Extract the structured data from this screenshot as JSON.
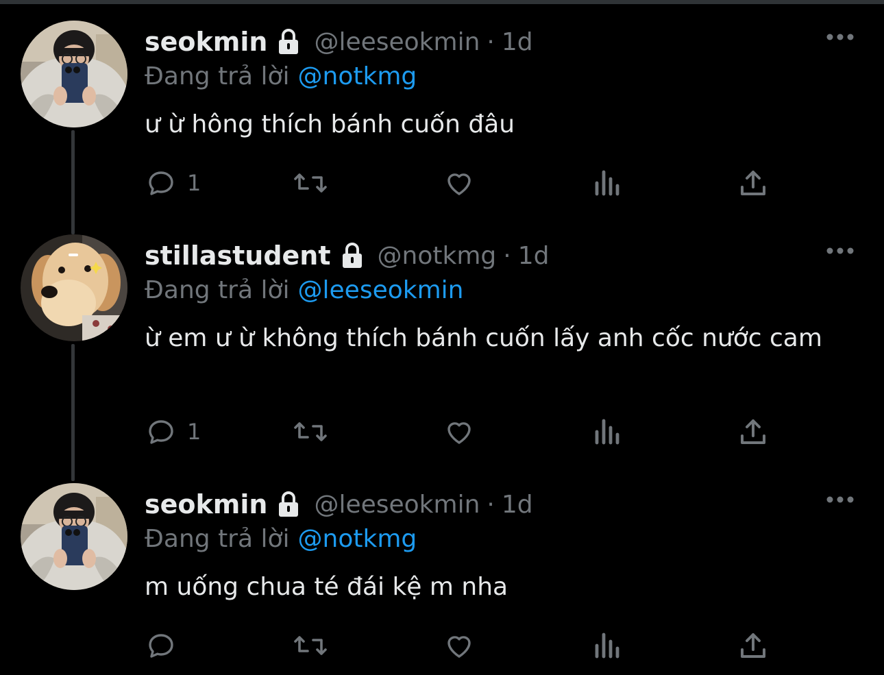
{
  "colors": {
    "background": "#000000",
    "text_primary": "#e7e9ea",
    "text_secondary": "#71767b",
    "accent": "#1d9bf0",
    "thread_line": "#333639"
  },
  "tweets": [
    {
      "display_name": "seokmin",
      "handle": "@leeseokmin",
      "separator": "·",
      "time": "1d",
      "reply_prefix": "Đang trả lời",
      "reply_to": "@notkmg",
      "text": "ư ừ hông thích bánh cuốn đâu",
      "reply_count": "1",
      "avatar": "selfie-avatar",
      "protected_icon": "lock-icon"
    },
    {
      "display_name": "stillastudent",
      "handle": "@notkmg",
      "separator": "·",
      "time": "1d",
      "reply_prefix": "Đang trả lời",
      "reply_to": "@leeseokmin",
      "text": "ừ em ư ừ không thích bánh cuốn lấy anh cốc nước cam",
      "reply_count": "1",
      "avatar": "puppy-avatar",
      "protected_icon": "lock-icon"
    },
    {
      "display_name": "seokmin",
      "handle": "@leeseokmin",
      "separator": "·",
      "time": "1d",
      "reply_prefix": "Đang trả lời",
      "reply_to": "@notkmg",
      "text": "m uống chua té đái kệ m nha",
      "reply_count": "",
      "avatar": "selfie-avatar",
      "protected_icon": "lock-icon"
    }
  ],
  "action_icons": [
    "reply-icon",
    "retweet-icon",
    "like-icon",
    "analytics-icon",
    "share-icon"
  ],
  "more_icon": "more-icon"
}
